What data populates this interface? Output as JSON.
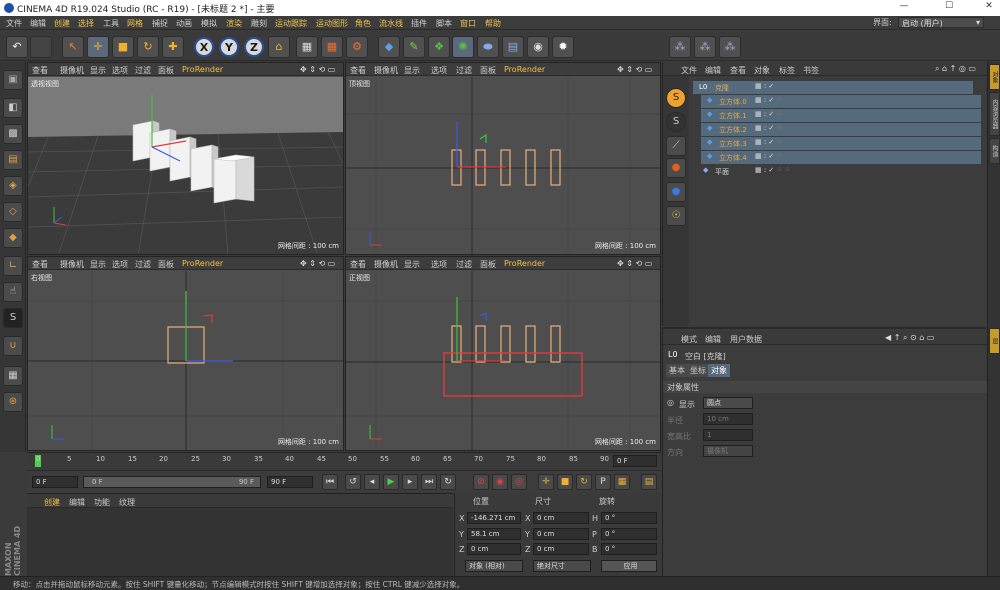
{
  "window": {
    "title": "CINEMA 4D R19.024 Studio (RC - R19) - [未标题 2 *] - 主要",
    "min": "—",
    "max": "☐",
    "close": "✕"
  },
  "menu": [
    "文件",
    "编辑",
    "创建",
    "选择",
    "工具",
    "网格",
    "捕捉",
    "动画",
    "模拟",
    "渲染",
    "雕刻",
    "运动跟踪",
    "运动图形",
    "角色",
    "流水线",
    "插件",
    "脚本",
    "窗口",
    "帮助"
  ],
  "layout": {
    "label": "界面:",
    "value": "启动 (用户)"
  },
  "viewports": [
    {
      "label": "透视视图",
      "grid": "网格间距 : 100 cm",
      "menu": [
        "查看",
        "摄像机",
        "显示",
        "选项",
        "过滤",
        "面板",
        "ProRender"
      ]
    },
    {
      "label": "顶视图",
      "grid": "网格间距 : 100 cm",
      "menu": [
        "查看",
        "摄像机",
        "显示",
        "选项",
        "过滤",
        "面板",
        "ProRender"
      ]
    },
    {
      "label": "右视图",
      "grid": "网格间距 : 100 cm",
      "menu": [
        "查看",
        "摄像机",
        "显示",
        "选项",
        "过滤",
        "面板",
        "ProRender"
      ]
    },
    {
      "label": "正视图",
      "grid": "网格间距 : 100 cm",
      "menu": [
        "查看",
        "摄像机",
        "显示",
        "选项",
        "过滤",
        "面板",
        "ProRender"
      ]
    }
  ],
  "timeline": {
    "ticks": [
      "0",
      "5",
      "10",
      "15",
      "20",
      "25",
      "30",
      "35",
      "40",
      "45",
      "50",
      "55",
      "60",
      "65",
      "70",
      "75",
      "80",
      "85",
      "90"
    ],
    "current": "0 F"
  },
  "transport": {
    "start": "0 F",
    "slider_start": "0 F",
    "slider_end": "90 F",
    "end": "90 F"
  },
  "material": {
    "tabs": [
      "创建",
      "编辑",
      "功能",
      "纹理"
    ]
  },
  "coords": {
    "headers": [
      "位置",
      "尺寸",
      "旋转"
    ],
    "rows": [
      {
        "axis": "X",
        "pos": "-146.271 cm",
        "saxis": "X",
        "size": "0 cm",
        "raxis": "H",
        "rot": "0 °"
      },
      {
        "axis": "Y",
        "pos": "58.1 cm",
        "saxis": "Y",
        "size": "0 cm",
        "raxis": "P",
        "rot": "0 °"
      },
      {
        "axis": "Z",
        "pos": "0 cm",
        "saxis": "Z",
        "size": "0 cm",
        "raxis": "B",
        "rot": "0 °"
      }
    ],
    "mode1": "对象 (相对)",
    "mode2": "绝对尺寸",
    "apply": "应用"
  },
  "objects": {
    "menu": [
      "文件",
      "编辑",
      "查看",
      "对象",
      "标签",
      "书签"
    ],
    "items": [
      {
        "name": "克隆",
        "level": 0,
        "selected": true
      },
      {
        "name": "立方体.0",
        "level": 1,
        "selected": true
      },
      {
        "name": "立方体.1",
        "level": 1,
        "selected": true
      },
      {
        "name": "立方体.2",
        "level": 1,
        "selected": true
      },
      {
        "name": "立方体.3",
        "level": 1,
        "selected": true
      },
      {
        "name": "立方体.4",
        "level": 1,
        "selected": true
      },
      {
        "name": "平面",
        "level": 0,
        "selected": false
      }
    ]
  },
  "attributes": {
    "menu": [
      "模式",
      "编辑",
      "用户数据"
    ],
    "object": "空白 [克隆]",
    "tabs": [
      "基本",
      "坐标",
      "对象"
    ],
    "section": "对象属性",
    "fields": [
      {
        "label": "显示",
        "value": "圆点",
        "enabled": true
      },
      {
        "label": "半径",
        "value": "10 cm",
        "enabled": false
      },
      {
        "label": "宽高比",
        "value": "1",
        "enabled": false
      },
      {
        "label": "方向",
        "value": "摄像机",
        "enabled": false
      }
    ]
  },
  "status": "移动：点击并拖动鼠标移动元素。按住 SHIFT 键量化移动；节点编辑模式时按住 SHIFT 键增加选择对象；按住 CTRL 键减少选择对象。",
  "right_tabs": [
    "对象",
    "内容浏览器",
    "构造",
    "层"
  ],
  "brand": "MAXON CINEMA 4D",
  "colors": {
    "accent": "#f2c04a",
    "selection": "#566a7e",
    "red_box": "#e03b3b"
  }
}
